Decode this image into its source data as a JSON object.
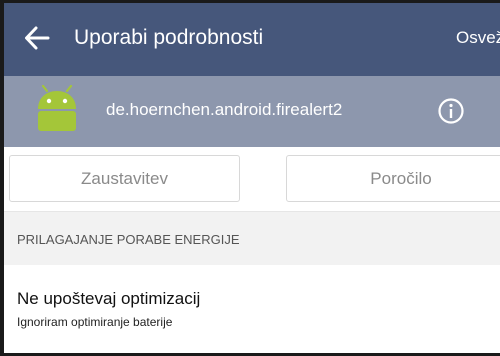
{
  "appbar": {
    "title": "Uporabi podrobnosti",
    "refresh_label": "Osveži",
    "color": "#46577b"
  },
  "app_info": {
    "package_name": "de.hoernchen.android.firealert2",
    "color": "#8d97ad",
    "icon": "android-icon"
  },
  "actions": {
    "stop_label": "Zaustavitev",
    "report_label": "Poročilo"
  },
  "section": {
    "header": "PRILAGAJANJE PORABE ENERGIJE"
  },
  "preference": {
    "title": "Ne upoštevaj optimizacij",
    "summary": "Ignoriram optimiranje baterije"
  }
}
